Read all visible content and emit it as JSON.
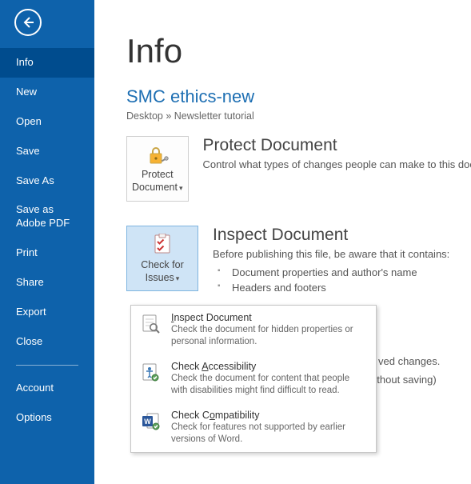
{
  "sidebar": {
    "items": [
      {
        "label": "Info"
      },
      {
        "label": "New"
      },
      {
        "label": "Open"
      },
      {
        "label": "Save"
      },
      {
        "label": "Save As"
      },
      {
        "label": "Save as Adobe PDF"
      },
      {
        "label": "Print"
      },
      {
        "label": "Share"
      },
      {
        "label": "Export"
      },
      {
        "label": "Close"
      }
    ],
    "bottom": [
      {
        "label": "Account"
      },
      {
        "label": "Options"
      }
    ]
  },
  "page": {
    "title": "Info",
    "doc_title": "SMC ethics-new",
    "breadcrumb": "Desktop » Newsletter tutorial"
  },
  "protect": {
    "btn_line1": "Protect",
    "btn_line2": "Document",
    "heading": "Protect Document",
    "desc": "Control what types of changes people can make to this docu"
  },
  "inspect": {
    "btn_line1": "Check for",
    "btn_line2": "Issues",
    "heading": "Inspect Document",
    "desc": "Before publishing this file, be aware that it contains:",
    "bullets": [
      "Document properties and author's name",
      "Headers and footers"
    ]
  },
  "ghost": {
    "line1": "ved changes.",
    "line2": "without saving)"
  },
  "dropdown": {
    "items": [
      {
        "title_pre": "",
        "title_u": "I",
        "title_post": "nspect Document",
        "desc": "Check the document for hidden properties or personal information."
      },
      {
        "title_pre": "Check ",
        "title_u": "A",
        "title_post": "ccessibility",
        "desc": "Check the document for content that people with disabilities might find difficult to read."
      },
      {
        "title_pre": "Check C",
        "title_u": "o",
        "title_post": "mpatibility",
        "desc": "Check for features not supported by earlier versions of Word."
      }
    ]
  }
}
